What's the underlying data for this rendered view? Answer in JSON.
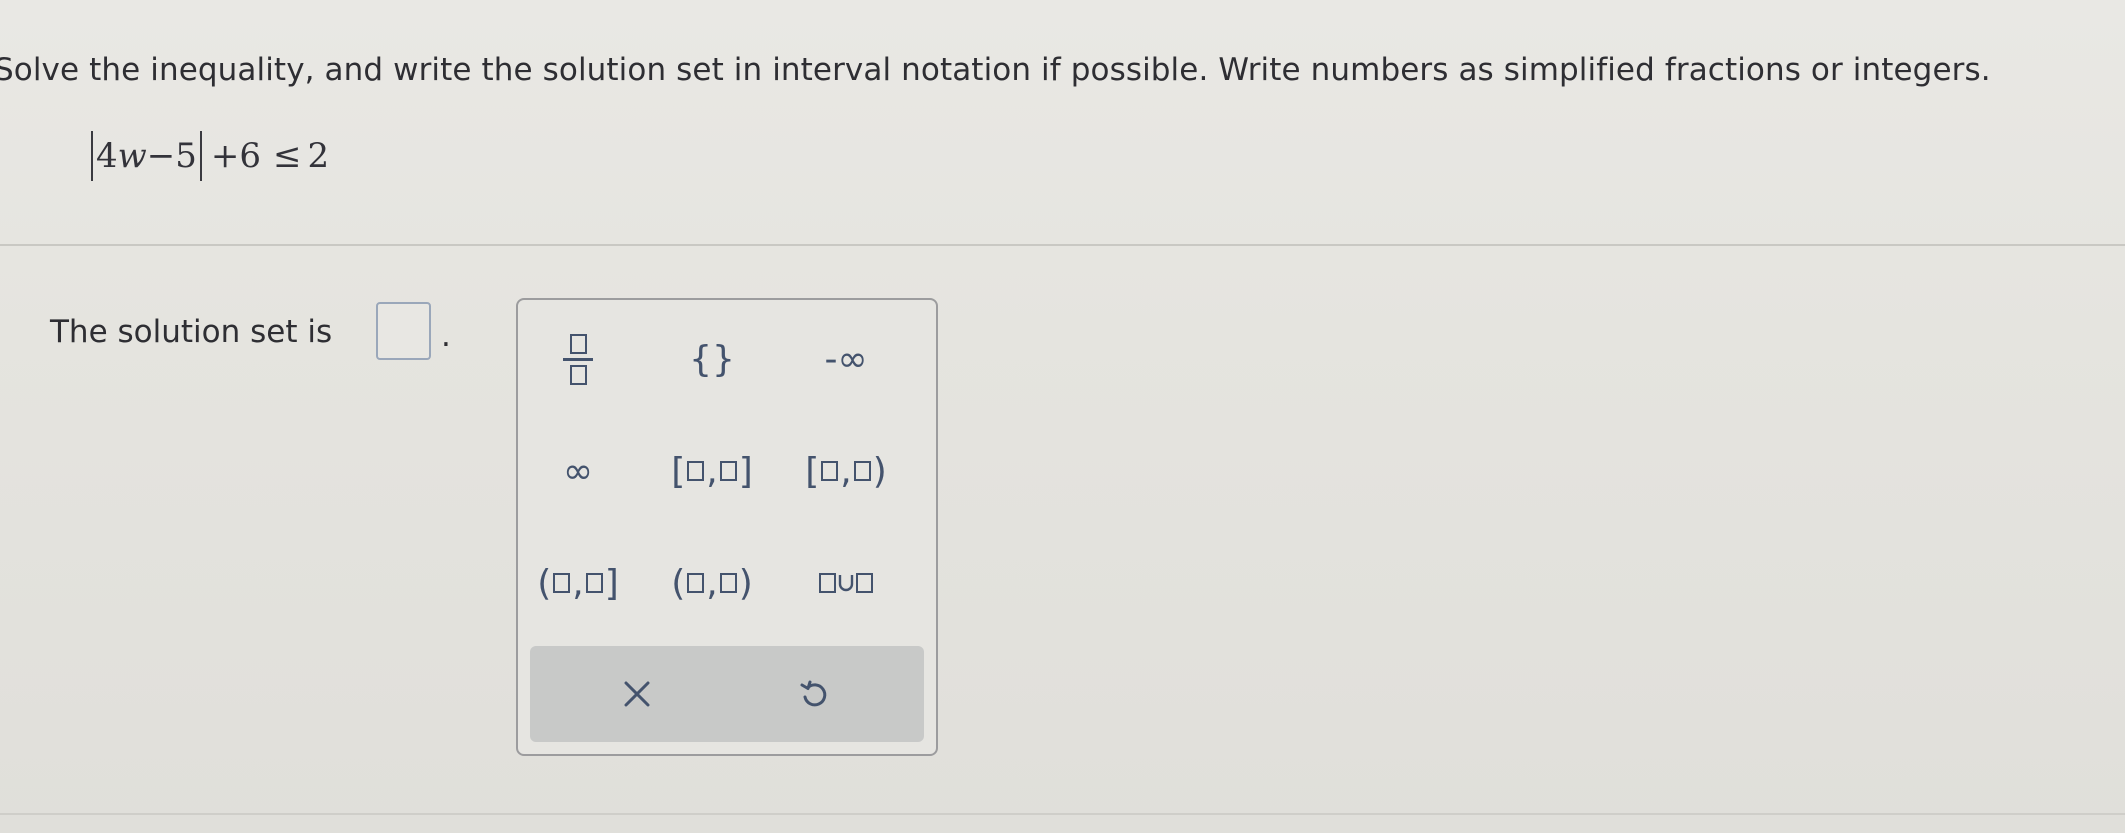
{
  "question": {
    "instructions": "Solve the inequality, and write the solution set in interval notation if possible. Write numbers as simplified fractions or integers."
  },
  "equation": {
    "abs_inner_coef": "4",
    "abs_inner_var": "w",
    "abs_inner_rest": "−5",
    "rest": "+6",
    "relation": "≤",
    "rhs": "2"
  },
  "answer": {
    "label": "The solution set is",
    "value": "",
    "trailing": "."
  },
  "palette": {
    "keys": {
      "empty_set": "{}",
      "neg_infinity": "-∞",
      "infinity": "∞"
    },
    "icons": {
      "fraction": "fraction-icon",
      "closed_interval": "closed-interval-icon",
      "closed_open_interval": "closed-open-interval-icon",
      "open_closed_interval": "open-closed-interval-icon",
      "open_interval": "open-interval-icon",
      "union": "union-icon",
      "clear": "x-icon",
      "undo": "undo-icon"
    },
    "colors": {
      "key_text": "#44536d",
      "action_bar": "#c8c9c8"
    }
  }
}
